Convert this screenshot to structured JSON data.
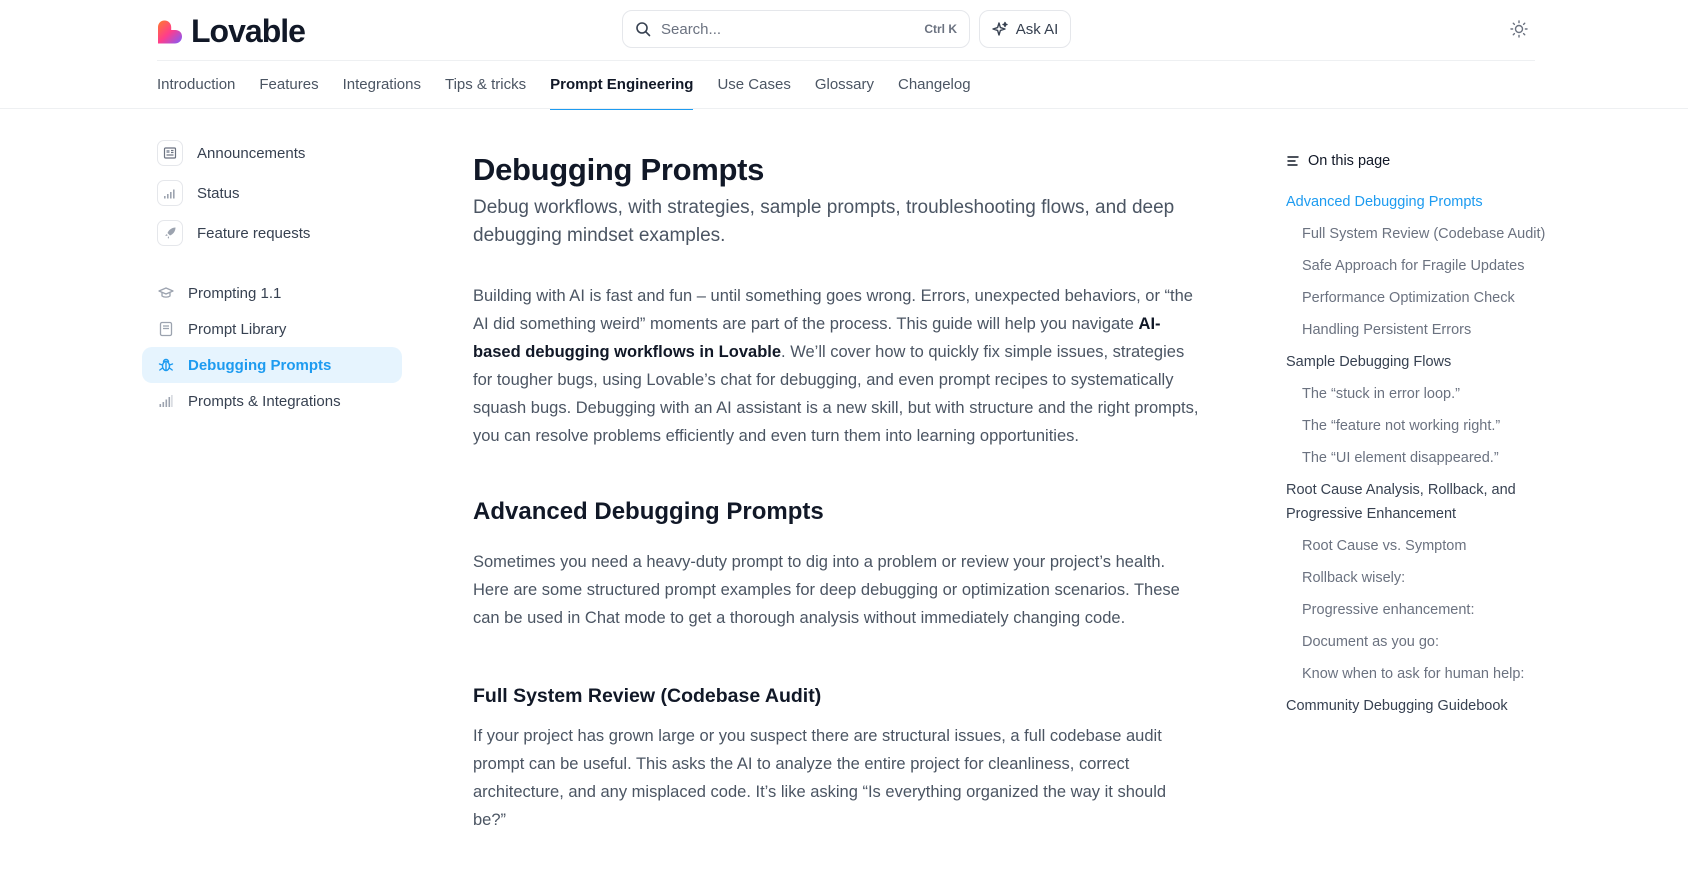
{
  "header": {
    "brand": "Lovable",
    "search_placeholder": "Search...",
    "search_shortcut": "Ctrl K",
    "ask_ai_label": "Ask AI",
    "brand_gradient": [
      "#ff4d2e",
      "#ff3d8b",
      "#7c5cff"
    ]
  },
  "tabs": [
    {
      "label": "Introduction",
      "active": false
    },
    {
      "label": "Features",
      "active": false
    },
    {
      "label": "Integrations",
      "active": false
    },
    {
      "label": "Tips & tricks",
      "active": false
    },
    {
      "label": "Prompt Engineering",
      "active": true
    },
    {
      "label": "Use Cases",
      "active": false
    },
    {
      "label": "Glossary",
      "active": false
    },
    {
      "label": "Changelog",
      "active": false
    }
  ],
  "sidebar": {
    "links": [
      {
        "label": "Announcements",
        "icon": "newspaper-icon"
      },
      {
        "label": "Status",
        "icon": "signal-icon"
      },
      {
        "label": "Feature requests",
        "icon": "rocket-icon"
      }
    ],
    "items": [
      {
        "label": "Prompting 1.1",
        "icon": "graduation-cap-icon",
        "active": false
      },
      {
        "label": "Prompt Library",
        "icon": "book-icon",
        "active": false
      },
      {
        "label": "Debugging Prompts",
        "icon": "bug-icon",
        "active": true
      },
      {
        "label": "Prompts & Integrations",
        "icon": "signal-icon",
        "active": false
      }
    ]
  },
  "main": {
    "title": "Debugging Prompts",
    "subtitle": "Debug workflows, with strategies, sample prompts, troubleshooting flows, and deep debugging mindset examples.",
    "intro_before": "Building with AI is fast and fun – until something goes wrong. Errors, unexpected behaviors, or “the AI did something weird” moments are part of the process. This guide will help you navigate ",
    "intro_bold": "AI-based debugging workflows in Lovable",
    "intro_after": ". We’ll cover how to quickly fix simple issues, strategies for tougher bugs, using Lovable’s chat for debugging, and even prompt recipes to systematically squash bugs. Debugging with an AI assistant is a new skill, but with structure and the right prompts, you can resolve problems efficiently and even turn them into learning opportunities.",
    "section_heading": "Advanced Debugging Prompts",
    "section_text": "Sometimes you need a heavy-duty prompt to dig into a problem or review your project’s health. Here are some structured prompt examples for deep debugging or optimization scenarios. These can be used in Chat mode to get a thorough analysis without immediately changing code.",
    "sub_heading": "Full System Review (Codebase Audit)",
    "sub_text": "If your project has grown large or you suspect there are structural issues, a full codebase audit prompt can be useful. This asks the AI to analyze the entire project for cleanliness, correct architecture, and any misplaced code. It’s like asking “Is everything organized the way it should be?”"
  },
  "toc": {
    "heading": "On this page",
    "items": [
      {
        "label": "Advanced Debugging Prompts",
        "level": 1,
        "active": true
      },
      {
        "label": "Full System Review (Codebase Audit)",
        "level": 2,
        "active": false
      },
      {
        "label": "Safe Approach for Fragile Updates",
        "level": 2,
        "active": false
      },
      {
        "label": "Performance Optimization Check",
        "level": 2,
        "active": false
      },
      {
        "label": "Handling Persistent Errors",
        "level": 2,
        "active": false
      },
      {
        "label": "Sample Debugging Flows",
        "level": 1,
        "active": false
      },
      {
        "label": "The “stuck in error loop.”",
        "level": 2,
        "active": false
      },
      {
        "label": "The “feature not working right.”",
        "level": 2,
        "active": false
      },
      {
        "label": "The “UI element disappeared.”",
        "level": 2,
        "active": false
      },
      {
        "label": "Root Cause Analysis, Rollback, and Progressive Enhancement",
        "level": 1,
        "active": false
      },
      {
        "label": "Root Cause vs. Symptom",
        "level": 2,
        "active": false
      },
      {
        "label": "Rollback wisely:",
        "level": 2,
        "active": false
      },
      {
        "label": "Progressive enhancement:",
        "level": 2,
        "active": false
      },
      {
        "label": "Document as you go:",
        "level": 2,
        "active": false
      },
      {
        "label": "Know when to ask for human help:",
        "level": 2,
        "active": false
      },
      {
        "label": "Community Debugging Guidebook",
        "level": 1,
        "active": false
      }
    ]
  },
  "colors": {
    "accent": "#1d9bf0",
    "active_bg": "#e6f4fe",
    "text_primary": "#111827",
    "text_body": "#4b5563"
  }
}
